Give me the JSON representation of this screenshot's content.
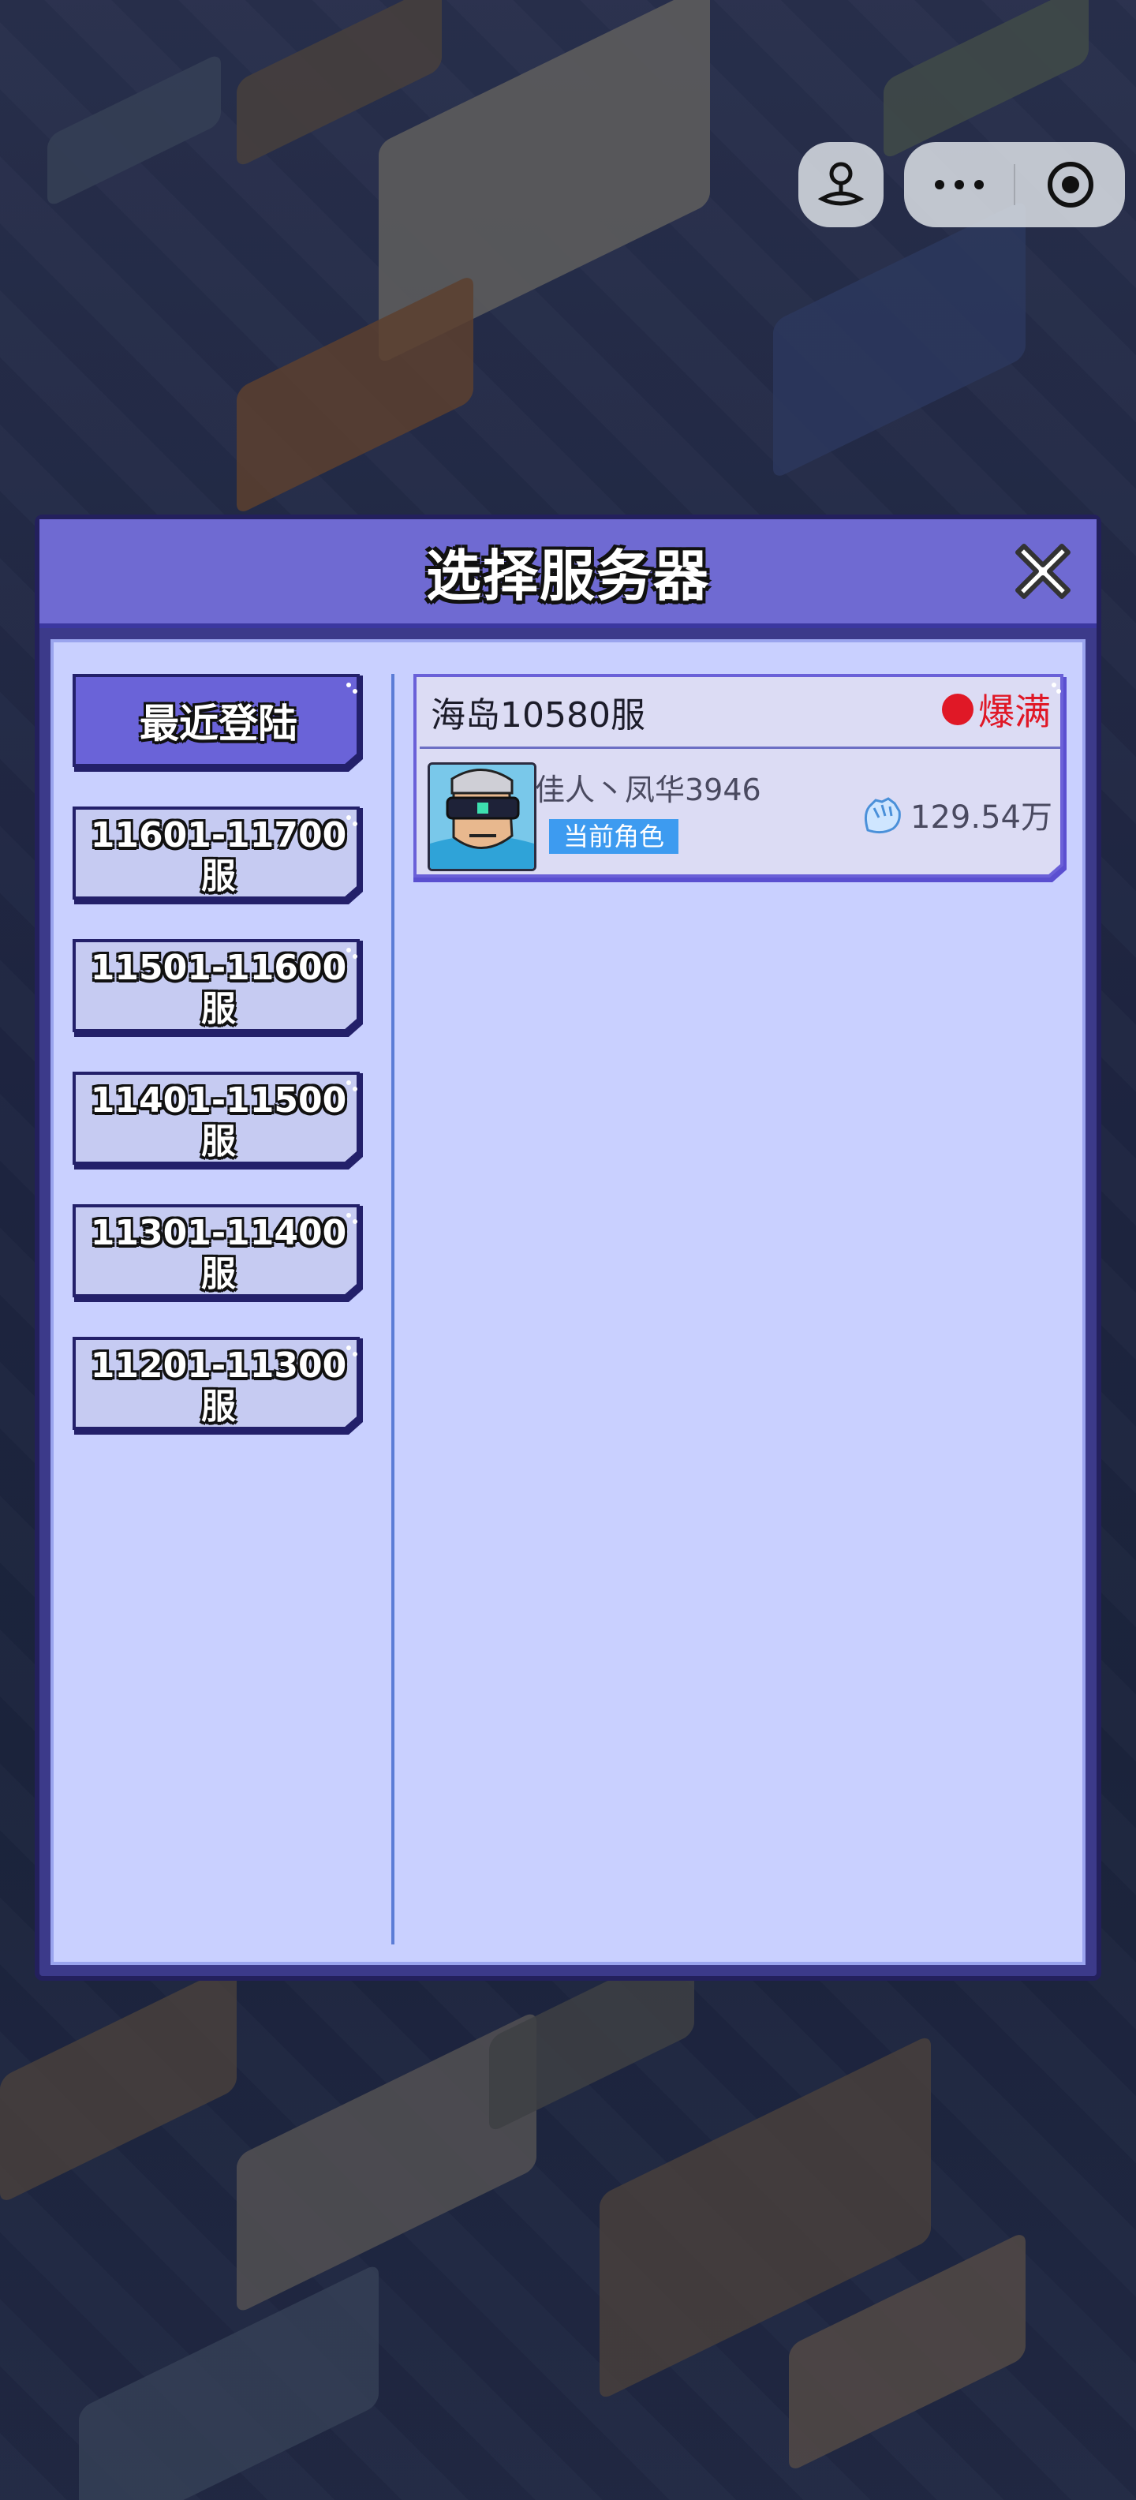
{
  "modal": {
    "title": "选择服务器"
  },
  "tabs": [
    {
      "label": "最近登陆",
      "active": true
    },
    {
      "label": "11601-11700\n服",
      "active": false
    },
    {
      "label": "11501-11600\n服",
      "active": false
    },
    {
      "label": "11401-11500\n服",
      "active": false
    },
    {
      "label": "11301-11400\n服",
      "active": false
    },
    {
      "label": "11201-11300\n服",
      "active": false
    }
  ],
  "server": {
    "name": "海岛10580服",
    "status": "爆满",
    "status_color": "#e01826",
    "character_name": "佳人丶凤华3946",
    "role_tag": "当前角色",
    "power": "129.54万",
    "power_icon": "fist-icon"
  },
  "capsule": {
    "left_icon": "joystick-icon",
    "menu_icon": "more-dots-icon",
    "close_icon": "target-circle-icon"
  },
  "colors": {
    "header": "#6f6ad2",
    "body": "#c9d0ff",
    "tab_active": "#6a63d8",
    "tab_inactive": "#c6cbf2"
  }
}
